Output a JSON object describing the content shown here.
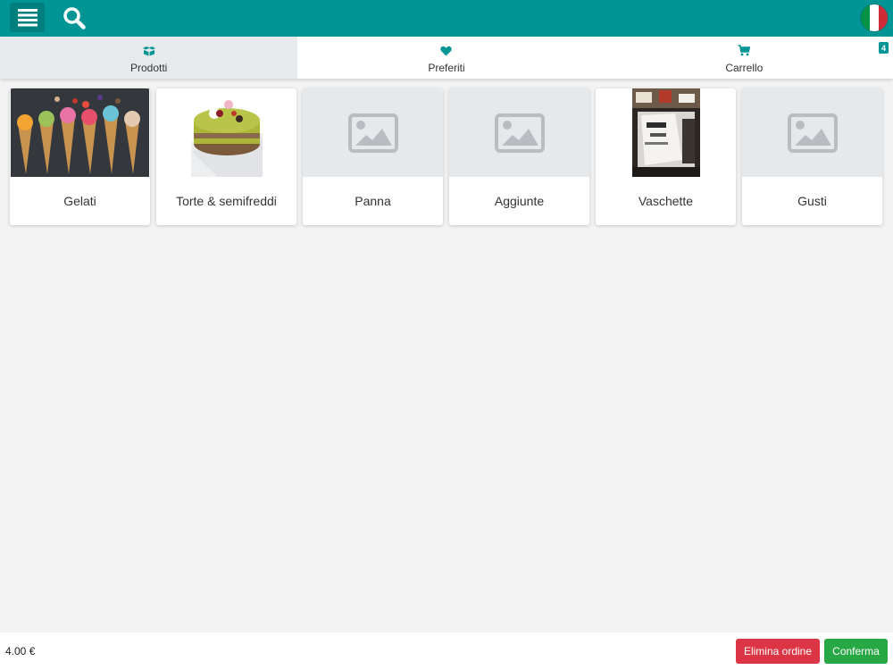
{
  "header": {
    "menu_icon": "hamburger-menu-icon",
    "search_icon": "search-icon",
    "language_flag": "italy-flag",
    "accent_color": "#009595",
    "flag_colors": [
      "#009246",
      "#ffffff",
      "#ce2b37"
    ]
  },
  "tabs": [
    {
      "label": "Prodotti",
      "icon": "boxes-icon",
      "active": true
    },
    {
      "label": "Preferiti",
      "icon": "heart-icon",
      "active": false
    },
    {
      "label": "Carrello",
      "icon": "cart-icon",
      "active": false,
      "badge": "4"
    }
  ],
  "categories": [
    {
      "label": "Gelati",
      "image": "ice-cream-cones-photo"
    },
    {
      "label": "Torte & semifreddi",
      "image": "pistachio-cake-photo"
    },
    {
      "label": "Panna",
      "image": "placeholder-image-icon"
    },
    {
      "label": "Aggiunte",
      "image": "placeholder-image-icon"
    },
    {
      "label": "Vaschette",
      "image": "ice-cream-tubs-photo"
    },
    {
      "label": "Gusti",
      "image": "placeholder-image-icon"
    }
  ],
  "footer": {
    "total": "4.00 €",
    "delete_label": "Elimina ordine",
    "confirm_label": "Conferma",
    "delete_color": "#dc3545",
    "confirm_color": "#28a745"
  }
}
